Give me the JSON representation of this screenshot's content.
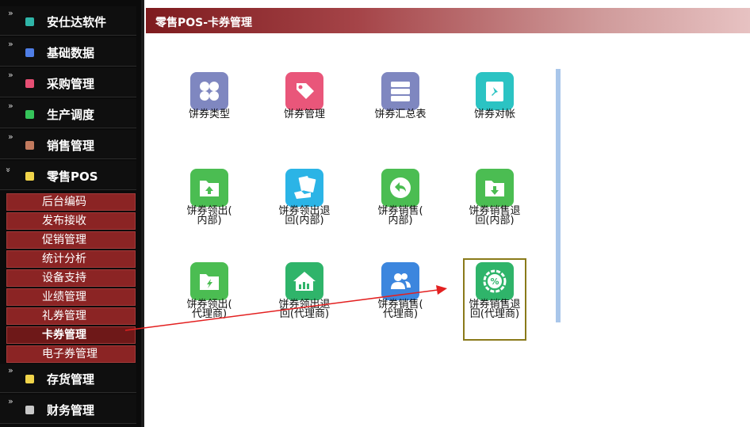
{
  "sidebar": {
    "chevron": "»",
    "modules": [
      {
        "label": "安仕达软件",
        "icon": "teal-square-icon",
        "color": "#2fb5a8"
      },
      {
        "label": "基础数据",
        "icon": "blue-square-icon",
        "color": "#4f7ee6"
      },
      {
        "label": "采购管理",
        "icon": "pink-square-icon",
        "color": "#e64f74"
      },
      {
        "label": "生产调度",
        "icon": "green-square-icon",
        "color": "#35c45a"
      },
      {
        "label": "销售管理",
        "icon": "brown-square-icon",
        "color": "#c27a5e"
      },
      {
        "label": "零售POS",
        "icon": "yellow-square-icon",
        "color": "#f0d44a"
      },
      {
        "label": "存货管理",
        "icon": "yellow-square-icon",
        "color": "#f0d44a"
      },
      {
        "label": "财务管理",
        "icon": "gray-square-icon",
        "color": "#c8c8c8"
      }
    ],
    "pos_submenu": [
      "后台编码",
      "发布接收",
      "促销管理",
      "统计分析",
      "设备支持",
      "业绩管理",
      "礼券管理",
      "卡券管理",
      "电子券管理"
    ],
    "active_submenu": "卡券管理"
  },
  "main": {
    "title": "零售POS-卡券管理",
    "tiles": [
      {
        "label_lines": [
          "饼券类型"
        ],
        "icon": "four-petal-icon",
        "color": "#7f87c0"
      },
      {
        "label_lines": [
          "饼券管理"
        ],
        "icon": "tag-icon",
        "color": "#e9567a"
      },
      {
        "label_lines": [
          "饼券汇总表"
        ],
        "icon": "server-stack-icon",
        "color": "#7f87c0"
      },
      {
        "label_lines": [
          "饼券对帐"
        ],
        "icon": "pin-icon",
        "color": "#2bc3c3"
      },
      {
        "label_lines": [
          "饼券领出(",
          "内部)"
        ],
        "icon": "folder-upload-icon",
        "color": "#4bbd52"
      },
      {
        "label_lines": [
          "饼券领出退",
          "回(内部)"
        ],
        "icon": "hand-cards-icon",
        "color": "#2bb4e6"
      },
      {
        "label_lines": [
          "饼券销售(",
          "内部)"
        ],
        "icon": "return-arrow-icon",
        "color": "#4bbd52"
      },
      {
        "label_lines": [
          "饼券销售退",
          "回(内部)"
        ],
        "icon": "folder-download-icon",
        "color": "#4bbd52"
      },
      {
        "label_lines": [
          "饼券领出(",
          "代理商)"
        ],
        "icon": "folder-bolt-icon",
        "color": "#4bbd52"
      },
      {
        "label_lines": [
          "饼券领出退",
          "回(代理商)"
        ],
        "icon": "house-chart-icon",
        "color": "#2fb46a"
      },
      {
        "label_lines": [
          "饼券销售(",
          "代理商)"
        ],
        "icon": "users-icon",
        "color": "#3c86de"
      },
      {
        "label_lines": [
          "饼券销售退",
          "回(代理商)"
        ],
        "icon": "percent-badge-icon",
        "color": "#2fb46a"
      }
    ],
    "highlighted_tile": "饼券销售退回(代理商)"
  },
  "annotation": {
    "arrow_color": "#e32020"
  }
}
